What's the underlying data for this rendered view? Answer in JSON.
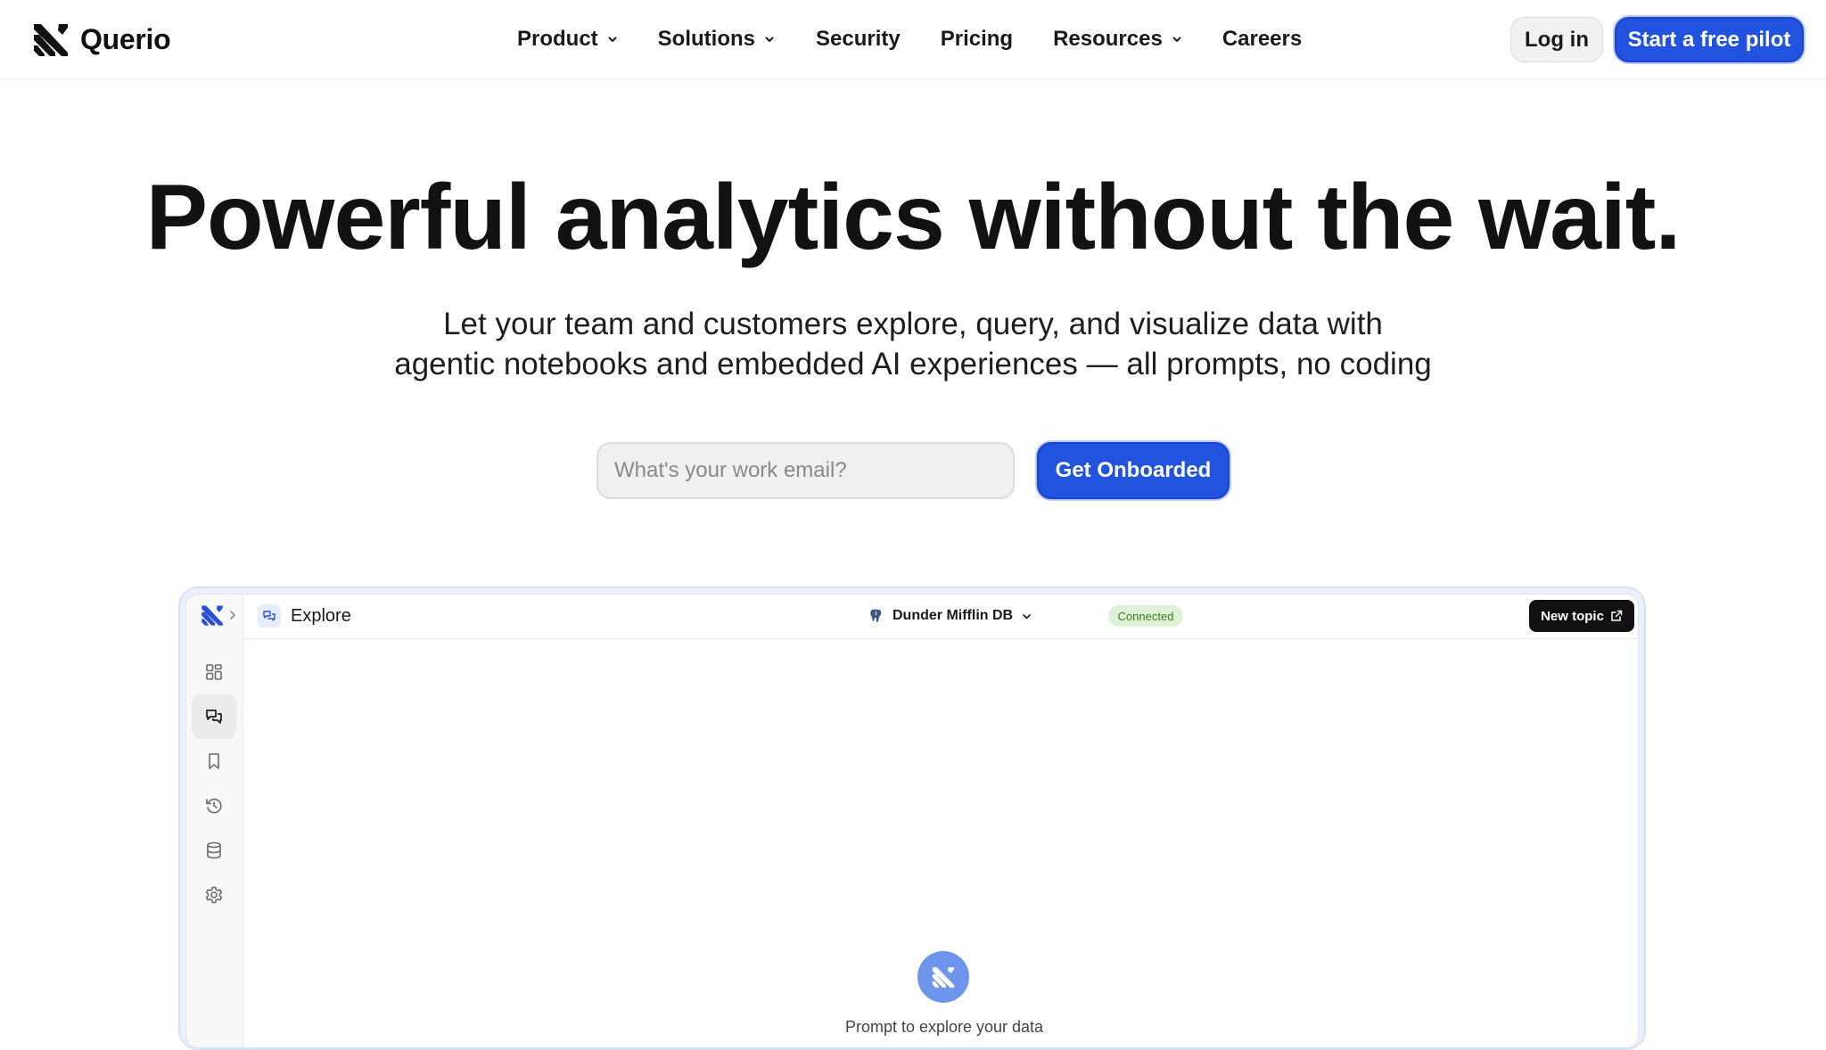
{
  "brand": {
    "name": "Querio"
  },
  "nav": {
    "items": [
      {
        "label": "Product",
        "has_dropdown": true
      },
      {
        "label": "Solutions",
        "has_dropdown": true
      },
      {
        "label": "Security",
        "has_dropdown": false
      },
      {
        "label": "Pricing",
        "has_dropdown": false
      },
      {
        "label": "Resources",
        "has_dropdown": true
      },
      {
        "label": "Careers",
        "has_dropdown": false
      }
    ],
    "login_label": "Log in",
    "cta_label": "Start a free pilot"
  },
  "hero": {
    "title": "Powerful analytics without the wait.",
    "subtitle_line1": "Let your team and customers explore, query, and visualize data with",
    "subtitle_line2": "agentic notebooks and embedded AI experiences — all prompts, no coding",
    "email_placeholder": "What's your work email?",
    "email_value": "",
    "submit_label": "Get Onboarded"
  },
  "app_preview": {
    "section_title": "Explore",
    "database_name": "Dunder Mifflin DB",
    "connection_status": "Connected",
    "new_topic_label": "New topic",
    "empty_state_hint": "Prompt to explore your data",
    "sidebar_icons": [
      "dashboard-grid-icon",
      "chat-icon",
      "bookmark-icon",
      "history-icon",
      "database-icon",
      "settings-icon"
    ],
    "active_sidebar_item": "chat-icon"
  },
  "colors": {
    "accent": "#2253de",
    "status_green_bg": "#dff2d6",
    "status_green_text": "#3b7a2a",
    "badge_blue": "#6d95ec"
  }
}
